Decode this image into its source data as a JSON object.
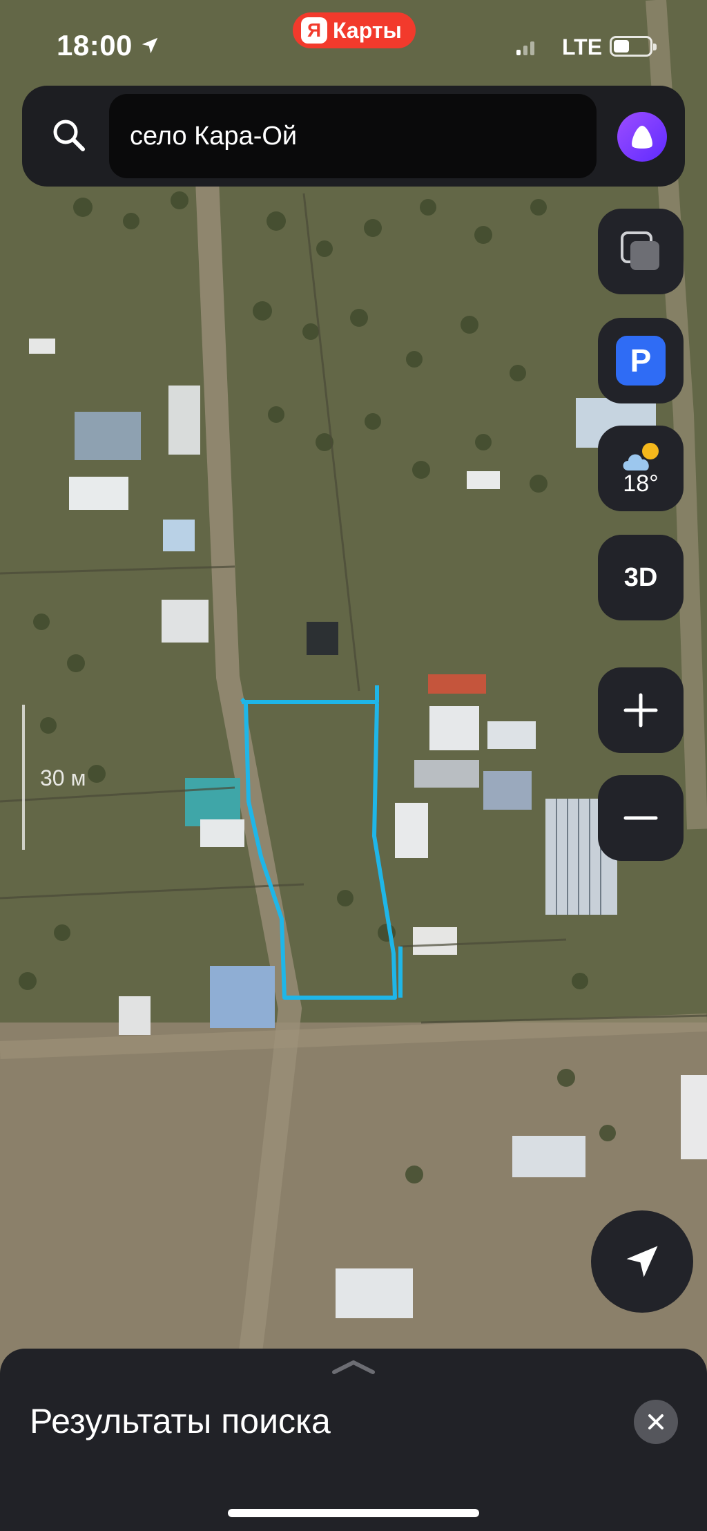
{
  "status_bar": {
    "time": "18:00",
    "app_badge_letter": "Я",
    "app_badge_label": "Карты",
    "network": "LTE"
  },
  "search": {
    "query": "село Кара-Ой",
    "icon": "search-icon",
    "assistant_icon": "alice-icon"
  },
  "map_controls": {
    "layers_icon": "layers-icon",
    "parking_label": "P",
    "weather_icon": "partly-cloudy-icon",
    "weather_temp": "18°",
    "threed_label": "3D",
    "zoom_in_label": "+",
    "zoom_out_icon": "minus-icon",
    "locate_icon": "location-arrow-icon"
  },
  "scale": {
    "label": "30 м"
  },
  "bottom_sheet": {
    "title": "Результаты поиска",
    "close_icon": "close-icon"
  },
  "colors": {
    "plot_outline": "#1fb6e8",
    "panel_bg": "#1d1e22",
    "brand_red": "#f23a2c",
    "parking_blue": "#2f6cf5",
    "alice_purple": "#7b3cff"
  }
}
